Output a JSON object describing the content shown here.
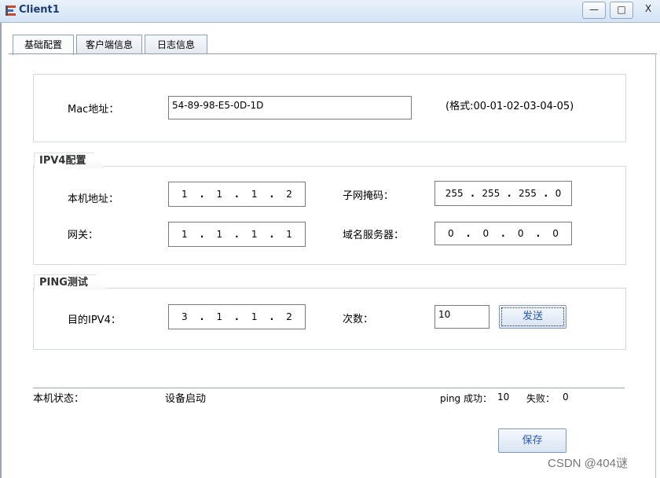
{
  "window": {
    "title": "Client1",
    "min_label": "—",
    "max_label": "□",
    "close_label": "X"
  },
  "tabs": [
    {
      "label": "基础配置"
    },
    {
      "label": "客户端信息"
    },
    {
      "label": "日志信息"
    }
  ],
  "mac": {
    "label": "Mac地址：",
    "value": "54-89-98-E5-0D-1D",
    "hint": "(格式:00-01-02-03-04-05)"
  },
  "ipv4": {
    "legend": "IPV4配置",
    "local_ip_label": "本机地址：",
    "local_ip": [
      "1",
      "1",
      "1",
      "2"
    ],
    "mask_label": "子网掩码：",
    "mask": [
      "255",
      "255",
      "255",
      "0"
    ],
    "gateway_label": "网关：",
    "gateway": [
      "1",
      "1",
      "1",
      "1"
    ],
    "dns_label": "域名服务器：",
    "dns": [
      "0",
      "0",
      "0",
      "0"
    ]
  },
  "ping": {
    "legend": "PING测试",
    "dest_label": "目的IPV4：",
    "dest": [
      "3",
      "1",
      "1",
      "2"
    ],
    "count_label": "次数：",
    "count": "10",
    "send_label": "发送"
  },
  "status": {
    "label": "本机状态：",
    "value": "设备启动",
    "success_label": "ping 成功：",
    "success": "10",
    "fail_label": "失败：",
    "fail": "0"
  },
  "save_label": "保存",
  "watermark": "CSDN @404谜"
}
